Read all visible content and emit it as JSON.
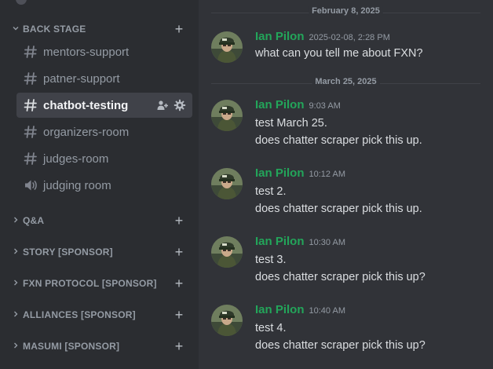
{
  "sidebar": {
    "categories": [
      {
        "label": "BACK STAGE",
        "expanded": true
      },
      {
        "label": "Q&A",
        "expanded": false
      },
      {
        "label": "STORY [SPONSOR]",
        "expanded": false
      },
      {
        "label": "FXN PROTOCOL [SPONSOR]",
        "expanded": false
      },
      {
        "label": "ALLIANCES [SPONSOR]",
        "expanded": false
      },
      {
        "label": "MASUMI [SPONSOR]",
        "expanded": false
      }
    ],
    "channels": [
      {
        "label": "mentors-support",
        "icon": "hash-icon"
      },
      {
        "label": "patner-support",
        "icon": "hash-icon"
      },
      {
        "label": "chatbot-testing",
        "icon": "hash-icon",
        "active": true
      },
      {
        "label": "organizers-room",
        "icon": "hash-icon"
      },
      {
        "label": "judges-room",
        "icon": "hash-icon"
      },
      {
        "label": "judging room",
        "icon": "speaker-icon"
      }
    ]
  },
  "chat": {
    "dividers": [
      "February 8, 2025",
      "March 25, 2025"
    ],
    "messages": [
      {
        "author": "Ian Pilon",
        "time": "2025-02-08, 2:28 PM",
        "lines": [
          "what can you tell me about FXN?"
        ]
      },
      {
        "author": "Ian Pilon",
        "time": "9:03 AM",
        "lines": [
          "test March 25.",
          "does chatter scraper pick this up."
        ]
      },
      {
        "author": "Ian Pilon",
        "time": "10:12 AM",
        "lines": [
          "test 2.",
          "does chatter scraper pick this up."
        ]
      },
      {
        "author": "Ian Pilon",
        "time": "10:30 AM",
        "lines": [
          "test 3.",
          "does chatter scraper pick this up?"
        ]
      },
      {
        "author": "Ian Pilon",
        "time": "10:40 AM",
        "lines": [
          "test 4.",
          "does chatter scraper pick this up?"
        ]
      }
    ]
  },
  "colors": {
    "sidebar_bg": "#2b2d31",
    "chat_bg": "#313338",
    "author": "#23a55a",
    "active_channel_bg": "#404249"
  }
}
